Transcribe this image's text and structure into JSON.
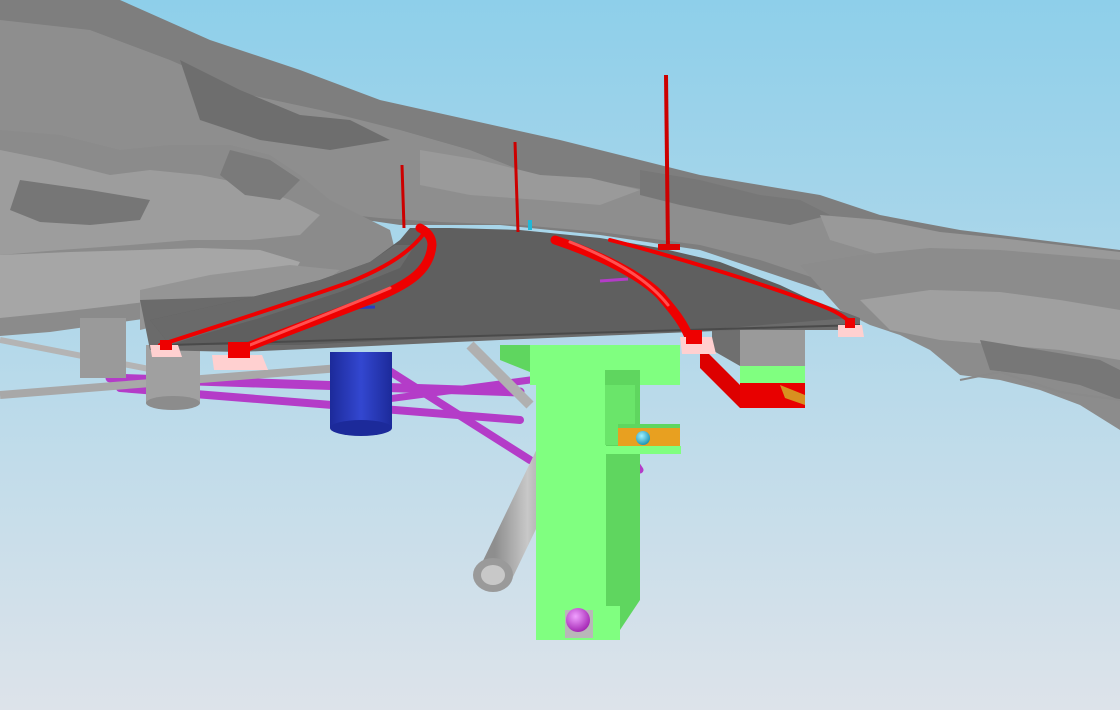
{
  "viewport": {
    "kind": "3d-model-render",
    "sky_top_color": "#8ecfea",
    "sky_bottom_color": "#dde3ea"
  },
  "colors": {
    "terrain": "#8a8a8a",
    "terrain_dark": "#6f6f6f",
    "terrain_light": "#9b9b9b",
    "road_deck": "#5f5f5f",
    "road_deck_edge": "#4a4a4a",
    "barrier": "#ee0000",
    "pole": "#cc0000",
    "pier": "#80ff80",
    "pier_shade": "#5fd65f",
    "pipe_gray": "#a9a9a9",
    "pipe_magenta": "#b43cc8",
    "tank_blue": "#2a3cc0",
    "bearing_pink": "#ffd0d0",
    "beam_orange": "#e8a020",
    "marker_cyan": "#20b8d8",
    "ball_magenta": "#cc44dd"
  },
  "objects": [
    {
      "name": "terrain-mesh",
      "material": "terrain"
    },
    {
      "name": "road-deck",
      "material": "road_deck"
    },
    {
      "name": "safety-barriers",
      "material": "barrier"
    },
    {
      "name": "light-poles",
      "material": "pole",
      "count": 3
    },
    {
      "name": "main-pier",
      "material": "pier"
    },
    {
      "name": "secondary-pier",
      "material": "pier"
    },
    {
      "name": "drainage-pipes",
      "material": "pipe_gray"
    },
    {
      "name": "utility-pipes",
      "material": "pipe_magenta"
    },
    {
      "name": "storage-tank",
      "material": "tank_blue"
    }
  ]
}
